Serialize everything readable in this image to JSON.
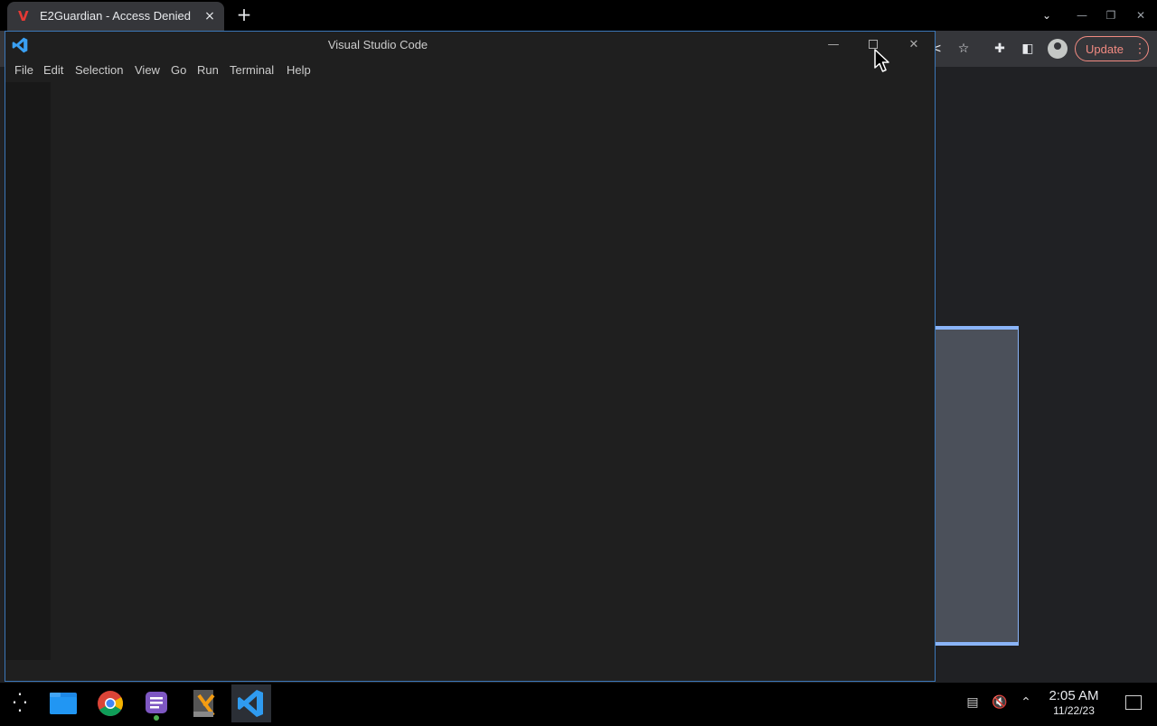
{
  "browser": {
    "tab_title": "E2Guardian - Access Denied",
    "tab_favicon": "e2guardian-v-icon",
    "tab_close": "×",
    "new_tab": "+",
    "tab_search": "⌄",
    "update_label": "Update",
    "update_menu": "⋮",
    "accent_color": "#f28b82"
  },
  "vscode": {
    "window_title": "Visual Studio Code",
    "menu": [
      "File",
      "Edit",
      "Selection",
      "View",
      "Go",
      "Run",
      "Terminal",
      "Help"
    ],
    "minimize": "—",
    "close": "✕",
    "accent_color": "#3b77b8"
  },
  "taskbar": {
    "time": "2:05 AM",
    "date": "11/22/23",
    "apps": [
      "file-manager-icon",
      "chrome-icon",
      "chat-app-icon",
      "ide-app-icon",
      "vscode-icon"
    ],
    "tray": [
      "clipboard-icon",
      "volume-muted-icon",
      "chevron-up-icon",
      "notifications-icon"
    ]
  }
}
